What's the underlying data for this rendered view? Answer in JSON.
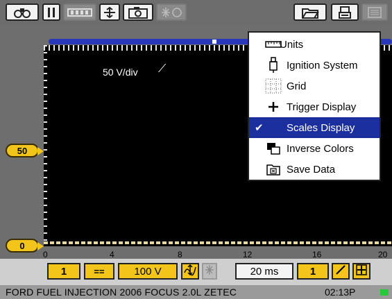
{
  "toolbar": {
    "left_buttons": [
      "binoculars-icon",
      "pause-icon",
      "battery-icon",
      "cursor-icon",
      "camera-icon",
      "asterisk-icon"
    ],
    "right_buttons": [
      "folder-icon",
      "printer-icon",
      "menu-icon"
    ]
  },
  "scope": {
    "scale_label": "50 V/div",
    "scale_mark": "⟋"
  },
  "y_markers": {
    "upper": "50",
    "lower": "0"
  },
  "x_axis": {
    "labels": [
      "0",
      "4",
      "8",
      "12",
      "16",
      "20"
    ]
  },
  "controls": {
    "channel": "1",
    "coupling": "==",
    "volts": "100 V",
    "time": "20 ms",
    "trigger_channel": "1"
  },
  "menu": {
    "items": [
      {
        "label": "Units",
        "icon": "ruler-icon"
      },
      {
        "label": "Ignition System",
        "icon": "spark-plug-icon"
      },
      {
        "label": "Grid",
        "icon": "grid-icon"
      },
      {
        "label": "Trigger Display",
        "icon": "plus-icon"
      },
      {
        "label": "Scales Display",
        "icon": "check-icon",
        "selected": true
      },
      {
        "label": "Inverse Colors",
        "icon": "inverse-colors-icon"
      },
      {
        "label": "Save Data",
        "icon": "save-data-icon"
      }
    ]
  },
  "status": {
    "vehicle": "FORD FUEL INJECTION 2006 FOCUS 2.0L ZETEC",
    "time": "02:13P"
  },
  "colors": {
    "accent_yellow": "#f3c51a",
    "selection_blue": "#1b2f9e",
    "strip_blue": "#2838b8"
  }
}
